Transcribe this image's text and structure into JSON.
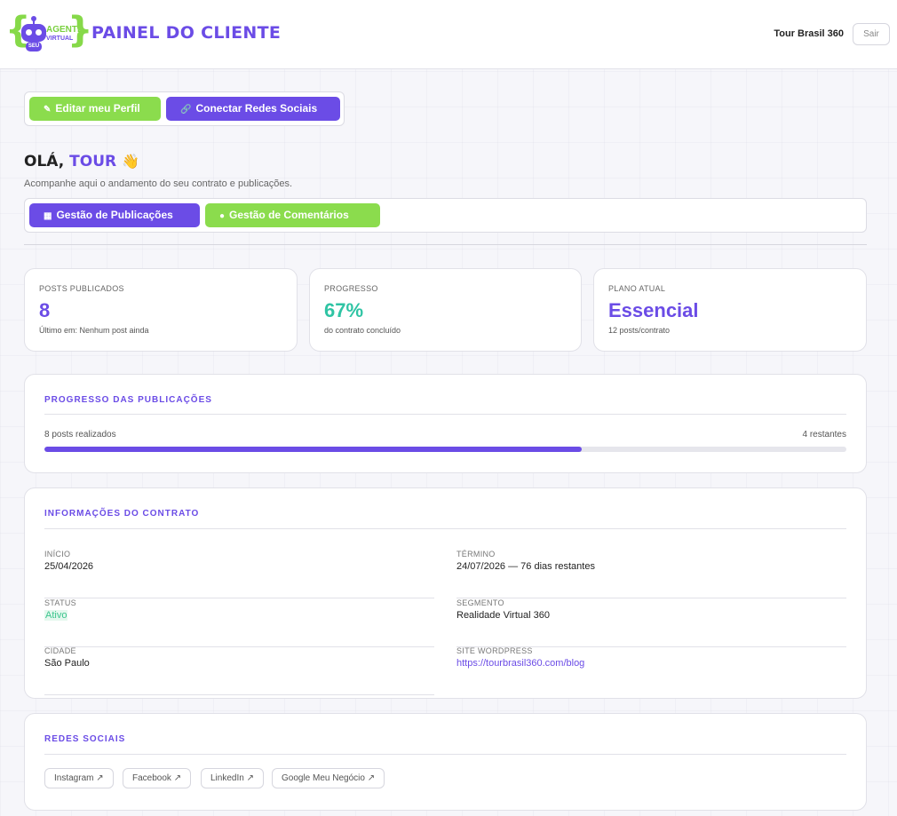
{
  "header": {
    "logo": {
      "brace_left": "{",
      "brace_right": "}",
      "top": "AGENTE",
      "bottom": "VIRTUAL",
      "badge": "SEU"
    },
    "title": "PAINEL DO CLIENTE",
    "user_name": "Tour Brasil 360",
    "logout_label": "Sair"
  },
  "actions": {
    "edit_profile": {
      "icon": "✎",
      "label": "Editar meu Perfil"
    },
    "connect_social": {
      "icon": "🔗",
      "label": "Conectar Redes Sociais"
    }
  },
  "greeting": {
    "prefix": "OLÁ, ",
    "name": "TOUR",
    "emoji": "👋",
    "subtitle": "Acompanhe aqui o andamento do seu contrato e publicações."
  },
  "tabs": {
    "publications": {
      "icon": "▦",
      "label": "Gestão de Publicações"
    },
    "comments": {
      "icon": "●",
      "label": "Gestão de Comentários"
    }
  },
  "stats": {
    "posts": {
      "label": "POSTS PUBLICADOS",
      "value": "8",
      "sub": "Último em: Nenhum post ainda"
    },
    "progress": {
      "label": "PROGRESSO",
      "value": "67%",
      "sub": "do contrato concluído"
    },
    "plan": {
      "label": "PLANO ATUAL",
      "value": "Essencial",
      "sub": "12 posts/contrato"
    }
  },
  "progress_section": {
    "title": "PROGRESSO DAS PUBLICAÇÕES",
    "done": "8 posts realizados",
    "remaining": "4 restantes",
    "fraction": 0.67
  },
  "contract": {
    "title": "INFORMAÇÕES DO CONTRATO",
    "start_label": "INÍCIO",
    "start": "25/04/2026",
    "end_label": "TÉRMINO",
    "end": "24/07/2026 — 76 dias restantes",
    "status_label": "STATUS",
    "status": "Ativo",
    "segment_label": "SEGMENTO",
    "segment": "Realidade Virtual 360",
    "city_label": "CIDADE",
    "city": "São Paulo",
    "site_label": "SITE WORDPRESS",
    "site": "https://tourbrasil360.com/blog"
  },
  "social": {
    "title": "REDES SOCIAIS",
    "links": [
      "Instagram ↗",
      "Facebook ↗",
      "LinkedIn ↗",
      "Google Meu Negócio ↗"
    ]
  },
  "colors": {
    "brand_purple": "#6b4ce6",
    "brand_green": "#8bdc4d",
    "progress_teal": "#2fc4a4"
  }
}
